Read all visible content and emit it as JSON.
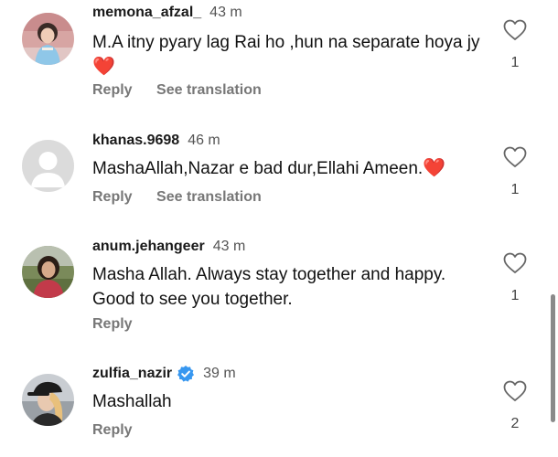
{
  "comments": [
    {
      "username": "memona_afzal_",
      "time": "43 m",
      "text": "M.A itny pyary lag Rai ho ,hun na separate hoya jy",
      "emoji": "❤️",
      "likes": "1",
      "reply_label": "Reply",
      "translate_label": "See translation",
      "avatar_icon": "child-photo-avatar"
    },
    {
      "username": "khanas.9698",
      "time": "46 m",
      "text": "MashaAllah,Nazar e bad dur,Ellahi Ameen.",
      "emoji": "❤️",
      "likes": "1",
      "reply_label": "Reply",
      "translate_label": "See translation",
      "avatar_icon": "default-user-avatar"
    },
    {
      "username": "anum.jehangeer",
      "time": "43 m",
      "text_line1": "Masha Allah.  Always stay together and happy.",
      "text_line2": "Good to see you together.",
      "likes": "1",
      "reply_label": "Reply",
      "avatar_icon": "woman-photo-avatar"
    },
    {
      "username": "zulfia_nazir",
      "time": "39 m",
      "text": "Mashallah",
      "likes": "2",
      "reply_label": "Reply",
      "verified": true,
      "avatar_icon": "woman-cap-photo-avatar"
    }
  ],
  "colors": {
    "verified_badge": "#3797f0",
    "heart_emoji": "#e0202d",
    "secondary_text": "#777777"
  }
}
